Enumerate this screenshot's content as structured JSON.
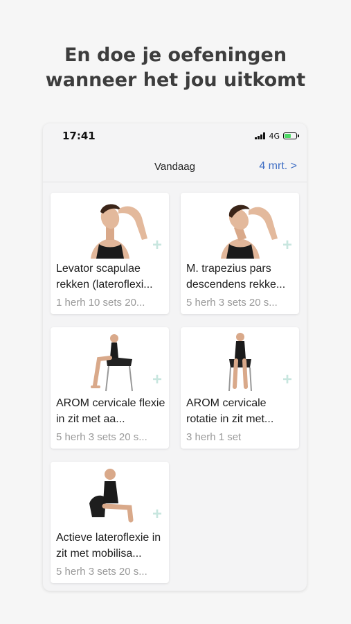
{
  "headline": {
    "line1": "En doe je oefeningen",
    "line2": "wanneer het jou uitkomt"
  },
  "status": {
    "time": "17:41",
    "network": "4G"
  },
  "nav": {
    "title": "Vandaag",
    "date_link": "4 mrt. >"
  },
  "exercises": [
    {
      "title": "Levator scapulae rekken (lateroflexi...",
      "meta": "1 herh 10 sets 20...",
      "icon": "plus-icon"
    },
    {
      "title": "M. trapezius pars descendens rekke...",
      "meta": "5 herh 3 sets 20 s...",
      "icon": "plus-icon"
    },
    {
      "title": "AROM cervicale flexie in zit met aa...",
      "meta": "5 herh 3 sets 20 s...",
      "icon": "plus-icon"
    },
    {
      "title": "AROM cervicale rotatie in zit met...",
      "meta": "3 herh 1 set",
      "icon": "plus-icon"
    },
    {
      "title": "Actieve lateroflexie in zit met mobilisa...",
      "meta": "5 herh 3 sets 20 s...",
      "icon": "plus-icon"
    }
  ],
  "colors": {
    "accent": "#3f6ec4",
    "plus": "#c8e6df",
    "headline": "#3d3d3d"
  }
}
